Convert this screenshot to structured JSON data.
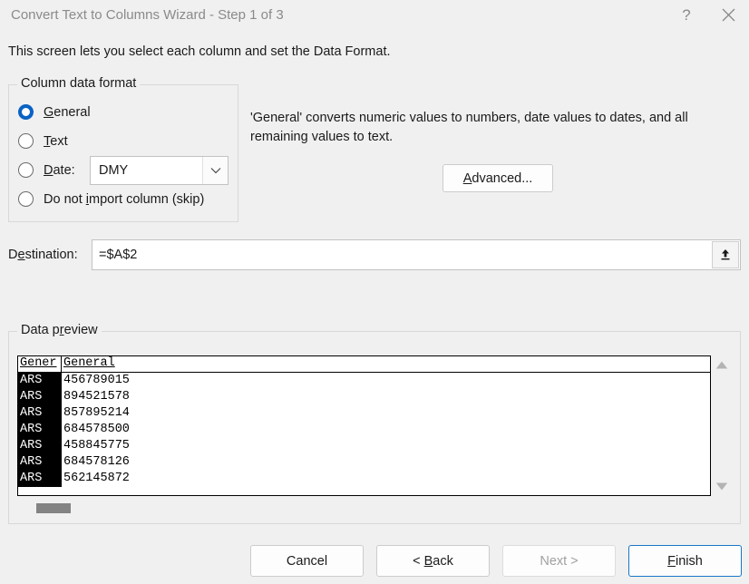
{
  "window": {
    "title": "Convert Text to Columns Wizard - Step 1 of 3",
    "help_icon": "question-mark-icon",
    "close_icon": "close-icon"
  },
  "intro_text": "This screen lets you select each column and set the Data Format.",
  "column_data_format": {
    "legend": "Column data format",
    "options": [
      {
        "label_pre": "",
        "label_accel": "G",
        "label_post": "eneral",
        "checked": true
      },
      {
        "label_pre": "",
        "label_accel": "T",
        "label_post": "ext",
        "checked": false
      },
      {
        "label_pre": "",
        "label_accel": "D",
        "label_post": "ate:",
        "checked": false
      },
      {
        "label_pre": "Do not ",
        "label_accel": "i",
        "label_post": "mport column (skip)",
        "checked": false
      }
    ],
    "date_format": {
      "value": "DMY",
      "arrow_icon": "chevron-down-icon"
    }
  },
  "description": {
    "text": "'General' converts numeric values to numbers, date values to dates, and all remaining values to text.",
    "advanced_pre": "",
    "advanced_accel": "A",
    "advanced_post": "dvanced..."
  },
  "destination": {
    "label_pre": "D",
    "label_accel": "e",
    "label_post": "stination:",
    "value": "=$A$2",
    "placeholder": "",
    "collapse_icon": "collapse-dialog-icon"
  },
  "data_preview": {
    "legend_pre": "Data p",
    "legend_accel": "r",
    "legend_post": "eview",
    "columns": [
      {
        "header": "Gener",
        "full_header": "General",
        "selected": true
      },
      {
        "header": "General",
        "full_header": "General",
        "selected": false
      }
    ],
    "rows": [
      {
        "col0": "ARS",
        "col1": "456789015"
      },
      {
        "col0": "ARS",
        "col1": "894521578"
      },
      {
        "col0": "ARS",
        "col1": "857895214"
      },
      {
        "col0": "ARS",
        "col1": "684578500"
      },
      {
        "col0": "ARS",
        "col1": "458845775"
      },
      {
        "col0": "ARS",
        "col1": "684578126"
      },
      {
        "col0": "ARS",
        "col1": "562145872"
      }
    ],
    "scroll_up_icon": "triangle-up-icon",
    "scroll_down_icon": "triangle-down-icon"
  },
  "buttons": {
    "cancel": "Cancel",
    "back_pre": "< ",
    "back_accel": "B",
    "back_post": "ack",
    "next": "Next >",
    "next_disabled": true,
    "finish_pre": "",
    "finish_accel": "F",
    "finish_post": "inish"
  },
  "colors": {
    "accent_blue": "#0a62c4",
    "default_button_border": "#1878c8",
    "window_bg": "#f0f0f0",
    "selected_column_bg": "#000000",
    "disabled_text": "#a0a0a0"
  }
}
